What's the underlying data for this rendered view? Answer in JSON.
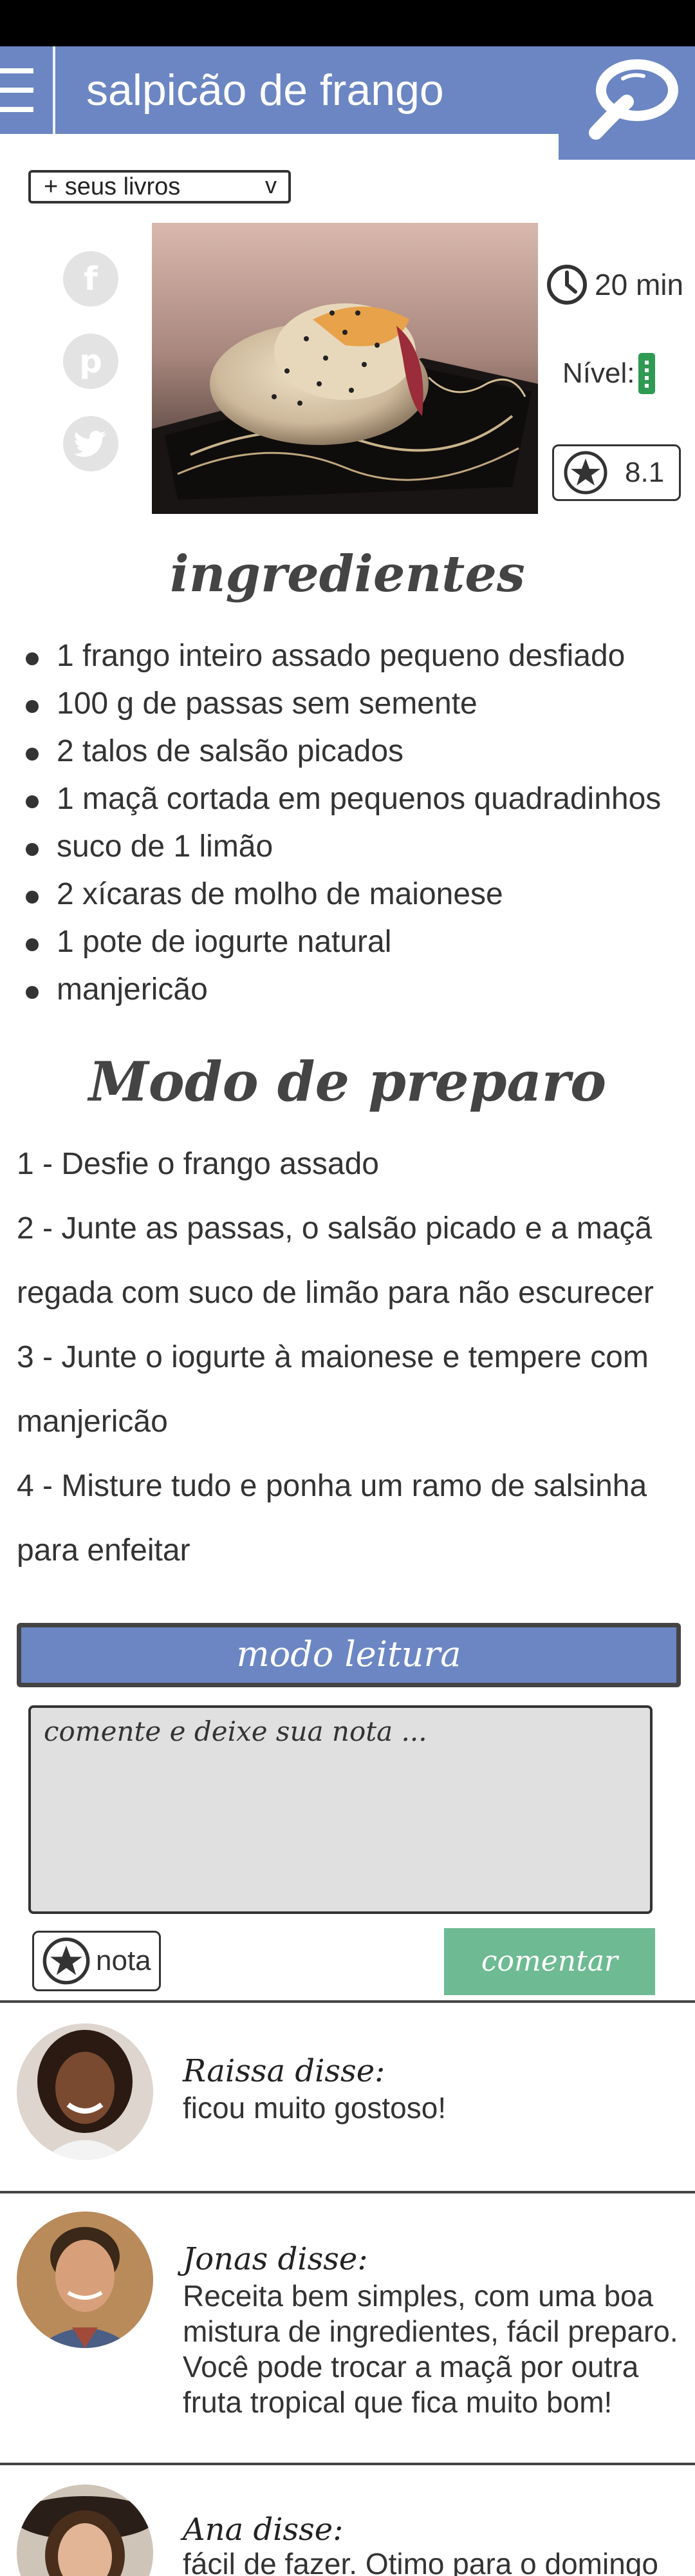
{
  "header": {
    "title": "salpicão de frango"
  },
  "books_select": {
    "label": "+ seus livros",
    "chevron": "v"
  },
  "social": {
    "facebook": "f",
    "pinterest": "p",
    "twitter": "t"
  },
  "recipe": {
    "time": "20 min",
    "level_label": "Nível:",
    "rating": "8.1"
  },
  "ingredients": {
    "title": "ingredientes",
    "items": [
      "1 frango inteiro assado pequeno desfiado",
      "100 g de passas sem semente",
      "2 talos de salsão picados",
      "1 maçã cortada em pequenos quadradinhos",
      "suco de 1 limão",
      "2 xícaras de molho de maionese",
      "1 pote de iogurte natural",
      "manjericão"
    ]
  },
  "preparation": {
    "title": "Modo de preparo",
    "steps": [
      "1 - Desfie o frango assado",
      "2 - Junte as passas, o salsão picado e a maçã regada com suco de limão para não escurecer",
      "3 - Junte o iogurte à maionese e tempere com manjericão",
      "4 - Misture tudo e ponha um ramo de salsinha para enfeitar"
    ]
  },
  "reading_mode": {
    "label": "modo leitura"
  },
  "comment_form": {
    "placeholder": "comente e deixe sua nota ...",
    "rate_label": "nota",
    "submit_label": "comentar"
  },
  "comments": [
    {
      "author": "Raissa disse:",
      "text": "ficou muito gostoso!"
    },
    {
      "author": "Jonas disse:",
      "text": "Receita bem simples, com uma boa mistura de ingredientes, fácil preparo. Você pode trocar a maçã por outra fruta tropical que fica muito bom!"
    },
    {
      "author": "Ana disse:",
      "text": "fácil de fazer. Otimo para o domingo"
    }
  ],
  "colors": {
    "header": "#6b86c2",
    "reading_button": "#6b86c2",
    "submit_button": "#6dba93",
    "level_indicator": "#2f9a52",
    "comment_box": "#e0e0e0"
  },
  "icons": [
    "menu-icon",
    "search-icon",
    "facebook-icon",
    "pinterest-icon",
    "twitter-icon",
    "clock-icon",
    "level-icon",
    "star-icon"
  ]
}
